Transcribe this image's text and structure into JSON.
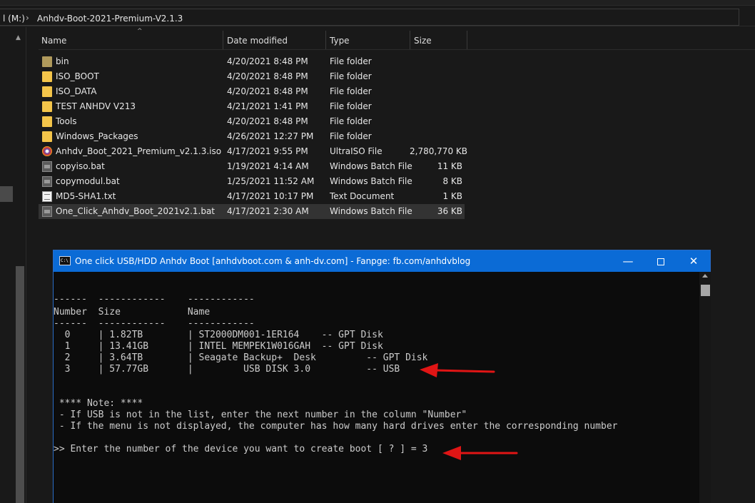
{
  "explorer": {
    "address": {
      "drive": "l (M:)",
      "separator": "›",
      "folder": "Anhdv-Boot-2021-Premium-V2.1.3"
    },
    "columns": {
      "name": "Name",
      "date": "Date modified",
      "type": "Type",
      "size": "Size"
    },
    "files": [
      {
        "icon": "folder-dark-icon",
        "name": "bin",
        "date": "4/20/2021 8:48 PM",
        "type": "File folder",
        "size": ""
      },
      {
        "icon": "folder-icon",
        "name": "ISO_BOOT",
        "date": "4/20/2021 8:48 PM",
        "type": "File folder",
        "size": ""
      },
      {
        "icon": "folder-icon",
        "name": "ISO_DATA",
        "date": "4/20/2021 8:48 PM",
        "type": "File folder",
        "size": ""
      },
      {
        "icon": "folder-icon",
        "name": "TEST ANHDV V213",
        "date": "4/21/2021 1:41 PM",
        "type": "File folder",
        "size": ""
      },
      {
        "icon": "folder-icon",
        "name": "Tools",
        "date": "4/20/2021 8:48 PM",
        "type": "File folder",
        "size": ""
      },
      {
        "icon": "folder-icon",
        "name": "Windows_Packages",
        "date": "4/26/2021 12:27 PM",
        "type": "File folder",
        "size": ""
      },
      {
        "icon": "iso-disc-icon",
        "name": "Anhdv_Boot_2021_Premium_v2.1.3.iso",
        "date": "4/17/2021 9:55 PM",
        "type": "UltraISO File",
        "size": "2,780,770 KB"
      },
      {
        "icon": "batch-file-icon",
        "name": "copyiso.bat",
        "date": "1/19/2021 4:14 AM",
        "type": "Windows Batch File",
        "size": "11 KB"
      },
      {
        "icon": "batch-file-icon",
        "name": "copymodul.bat",
        "date": "1/25/2021 11:52 AM",
        "type": "Windows Batch File",
        "size": "8 KB"
      },
      {
        "icon": "text-file-icon",
        "name": "MD5-SHA1.txt",
        "date": "4/17/2021 10:17 PM",
        "type": "Text Document",
        "size": "1 KB"
      },
      {
        "icon": "batch-file-icon",
        "name": "One_Click_Anhdv_Boot_2021v2.1.bat",
        "date": "4/17/2021 2:30 AM",
        "type": "Windows Batch File",
        "size": "36 KB",
        "selected": true
      }
    ]
  },
  "console": {
    "icon_label": "C:\\",
    "title": "One click USB/HDD Anhdv Boot [anhdvboot.com & anh-dv.com] -  Fanpge: fb.com/anhdvblog",
    "buttons": {
      "minimize": "—",
      "close": "✕"
    },
    "lines": [
      "------  ------------    ------------",
      "Number  Size            Name",
      "------  ------------    ------------",
      "  0     | 1.82TB        | ST2000DM001-1ER164    -- GPT Disk",
      "  1     | 13.41GB       | INTEL MEMPEK1W016GAH  -- GPT Disk",
      "  2     | 3.64TB        | Seagate Backup+  Desk         -- GPT Disk",
      "  3     | 57.77GB       |         USB DISK 3.0          -- USB",
      "",
      " **** Note: ****",
      " - If USB is not in the list, enter the next number in the column \"Number\"",
      " - If the menu is not displayed, the computer has how many hard drives enter the corresponding number",
      "",
      ">> Enter the number of the device you want to create boot [ ? ] = 3"
    ]
  },
  "colors": {
    "title_bar": "#0b6bd6",
    "annotation_arrow": "#e01515",
    "console_text": "#cccccc"
  }
}
